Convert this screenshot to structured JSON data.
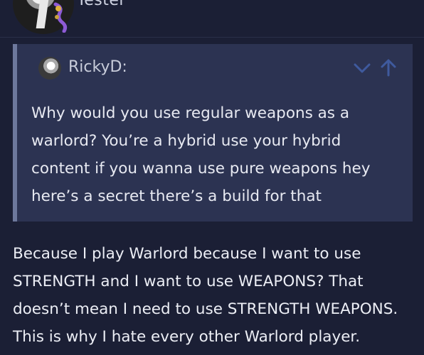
{
  "user": {
    "title": "Tester"
  },
  "quote": {
    "author": "RickyD:",
    "lines": [
      "Why would you use regular weapons as a",
      "warlord? You’re a hybrid use your hybrid",
      "content if you wanna use pure weapons hey",
      "here’s a secret there’s a build for that"
    ]
  },
  "post": {
    "lines": [
      "Because I play Warlord because I want to use",
      "STRENGTH and I want to use WEAPONS? That",
      "doesn’t mean I need to use STRENGTH WEAPONS.",
      "This is why I hate every other Warlord player."
    ]
  },
  "icons": {
    "expand": "chevron-down-icon",
    "jump": "arrow-up-icon",
    "badge": "flair-badge-icon"
  },
  "colors": {
    "background": "#1b1f35",
    "quote_background": "#2c3352",
    "quote_border": "#6d789c",
    "icon_accent": "#3f5a9e"
  }
}
